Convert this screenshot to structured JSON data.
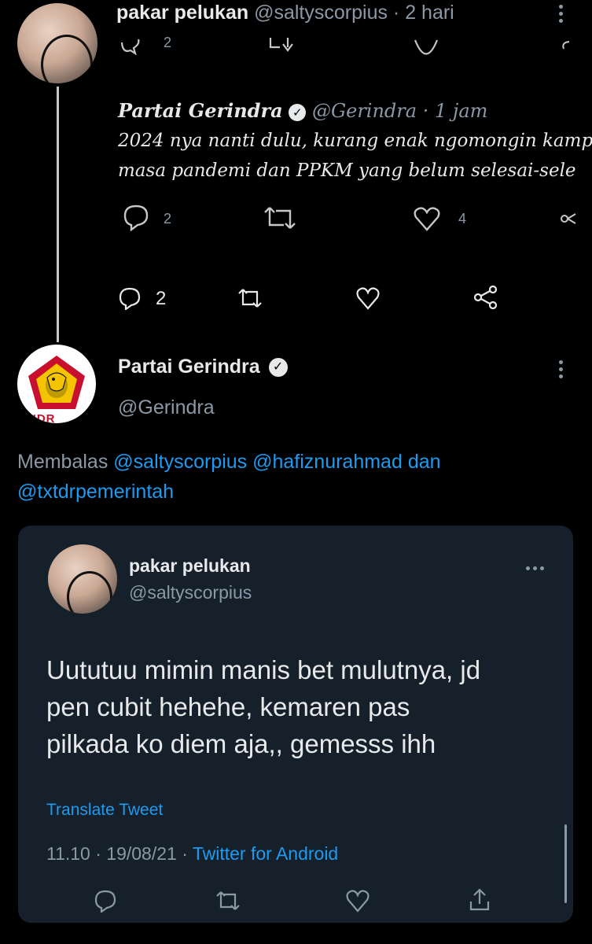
{
  "tweet1": {
    "name": "pakar pelukan",
    "handle": "@saltyscorpius",
    "sep": "·",
    "time": "2 hari",
    "top_reply_count": "2"
  },
  "quoted": {
    "name": "Partai Gerindra",
    "handle": "@Gerindra",
    "time": "· 1 jam",
    "line1": "2024 nya nanti dulu, kurang enak ngomongin kamp",
    "line2": "masa pandemi dan PPKM yang belum selesai-sele",
    "reply_count": "2",
    "like_count": "4"
  },
  "tweet1_actions": {
    "reply_count": "2"
  },
  "tweet2": {
    "name": "Partai Gerindra",
    "handle": "@Gerindra",
    "logo_text": "RINDR",
    "reply_prefix": "Membalas",
    "mention1": "@saltyscorpius",
    "mention2": "@hafiznurahmad",
    "conj": "dan",
    "mention3": "@txtdrpemerintah"
  },
  "reply_card": {
    "name": "pakar pelukan",
    "handle": "@saltyscorpius",
    "text_line1": "Uututuu mimin manis bet mulutnya, jd",
    "text_line2": "pen cubit hehehe, kemaren pas",
    "text_line3": "pilkada ko diem aja,, gemesss ihh",
    "translate": "Translate Tweet",
    "meta_time": "11.10 · 19/08/21 ·",
    "meta_source": "Twitter for Android"
  },
  "colors": {
    "background": "#000000",
    "card": "#15202b",
    "link": "#1d9bf0",
    "muted": "#8b98a5",
    "gerindra_red": "#c8102e"
  }
}
